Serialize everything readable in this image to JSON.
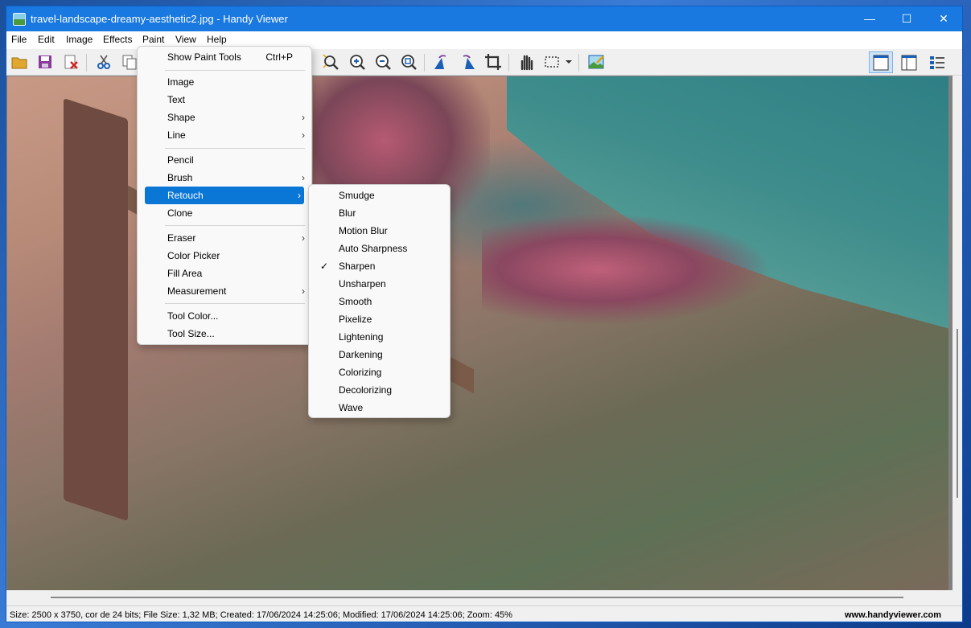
{
  "window": {
    "title": "travel-landscape-dreamy-aesthetic2.jpg - Handy Viewer",
    "icon": "app-image-icon"
  },
  "window_controls": {
    "minimize": "—",
    "maximize": "☐",
    "close": "✕"
  },
  "menubar": [
    "File",
    "Edit",
    "Image",
    "Effects",
    "Paint",
    "View",
    "Help"
  ],
  "toolbar_icons": [
    "open-folder-icon",
    "save-icon",
    "delete-icon",
    "cut-icon",
    "copy-icon",
    "zoom-fit-icon",
    "zoom-in-icon",
    "zoom-out-icon",
    "zoom-actual-icon",
    "rotate-left-icon",
    "rotate-right-icon",
    "crop-icon",
    "hand-icon",
    "select-rect-icon",
    "dropdown-icon",
    "edit-image-icon",
    "layout-single-icon",
    "layout-double-icon",
    "layout-list-icon"
  ],
  "paint_menu": {
    "show_paint_tools": {
      "label": "Show Paint Tools",
      "shortcut": "Ctrl+P"
    },
    "group1": [
      "Image",
      "Text",
      "Shape",
      "Line"
    ],
    "group2": [
      "Pencil",
      "Brush",
      "Retouch",
      "Clone"
    ],
    "group3": [
      "Eraser",
      "Color Picker",
      "Fill Area",
      "Measurement"
    ],
    "group4": [
      "Tool Color...",
      "Tool Size..."
    ]
  },
  "retouch_menu": [
    "Smudge",
    "Blur",
    "Motion Blur",
    "Auto Sharpness",
    "Sharpen",
    "Unsharpen",
    "Smooth",
    "Pixelize",
    "Lightening",
    "Darkening",
    "Colorizing",
    "Decolorizing",
    "Wave"
  ],
  "retouch_checked": "Sharpen",
  "status": {
    "info": "Size: 2500 x 3750, cor de 24 bits; File Size: 1,32 MB; Created: 17/06/2024 14:25:06; Modified: 17/06/2024 14:25:06; Zoom: 45%",
    "url": "www.handyviewer.com"
  },
  "colors": {
    "titlebar": "#1979e0",
    "highlight": "#0a76d6"
  }
}
